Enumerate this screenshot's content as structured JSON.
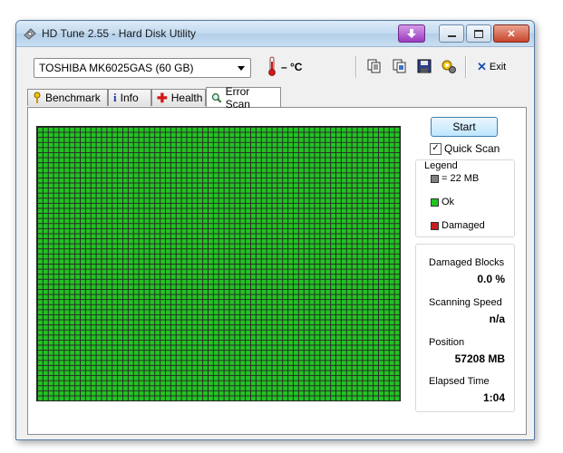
{
  "window": {
    "title": "HD Tune 2.55 - Hard Disk Utility"
  },
  "toolbar": {
    "drive": "TOSHIBA MK6025GAS (60 GB)",
    "temperature": "– °C",
    "exit_label": "Exit",
    "icons": [
      "copy-text-icon",
      "copy-screenshot-icon",
      "save-icon",
      "options-icon"
    ]
  },
  "tabs": [
    {
      "label": "Benchmark",
      "icon": "benchmark-icon"
    },
    {
      "label": "Info",
      "icon": "info-icon"
    },
    {
      "label": "Health",
      "icon": "health-icon"
    },
    {
      "label": "Error Scan",
      "icon": "magnifier-icon",
      "active": true
    }
  ],
  "scan": {
    "start_label": "Start",
    "quick_scan_label": "Quick Scan",
    "quick_scan_checked": true,
    "block_status": "Ok",
    "block_color": "#22c322",
    "damaged_color": "#c81e1e"
  },
  "legend": {
    "title": "Legend",
    "items": [
      {
        "label": "= 22 MB",
        "color": "#7f7f7f"
      },
      {
        "label": "Ok",
        "color": "#22c322"
      },
      {
        "label": "Damaged",
        "color": "#c81e1e"
      }
    ]
  },
  "stats": {
    "damaged_blocks_label": "Damaged Blocks",
    "damaged_blocks_value": "0.0 %",
    "scanning_speed_label": "Scanning Speed",
    "scanning_speed_value": "n/a",
    "position_label": "Position",
    "position_value": "57208 MB",
    "elapsed_label": "Elapsed Time",
    "elapsed_value": "1:04"
  }
}
